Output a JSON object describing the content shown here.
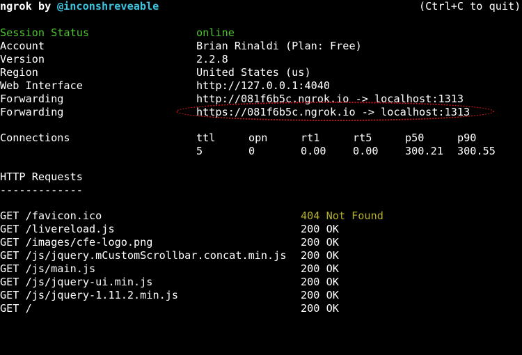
{
  "header": {
    "app_name": "ngrok",
    "by_text": "by",
    "author": "@inconshreveable",
    "quit_hint": "(Ctrl+C to quit)"
  },
  "status": [
    {
      "label": "Session Status",
      "value": "online"
    },
    {
      "label": "Account",
      "value": "Brian Rinaldi (Plan: Free)"
    },
    {
      "label": "Version",
      "value": "2.2.8"
    },
    {
      "label": "Region",
      "value": "United States (us)"
    },
    {
      "label": "Web Interface",
      "value": "http://127.0.0.1:4040"
    },
    {
      "label": "Forwarding",
      "value": "http://081f6b5c.ngrok.io -> localhost:1313"
    },
    {
      "label": "Forwarding",
      "value": "https://081f6b5c.ngrok.io -> localhost:1313"
    }
  ],
  "connections": {
    "label": "Connections",
    "headers": [
      "ttl",
      "opn",
      "rt1",
      "rt5",
      "p50",
      "p90"
    ],
    "values": [
      "5",
      "0",
      "0.00",
      "0.00",
      "300.21",
      "300.55"
    ]
  },
  "requests": {
    "title": "HTTP Requests",
    "underline": "-------------",
    "rows": [
      {
        "request": "GET /favicon.ico",
        "status": "404 Not Found"
      },
      {
        "request": "GET /livereload.js",
        "status": "200 OK"
      },
      {
        "request": "GET /images/cfe-logo.png",
        "status": "200 OK"
      },
      {
        "request": "GET /js/jquery.mCustomScrollbar.concat.min.js",
        "status": "200 OK"
      },
      {
        "request": "GET /js/main.js",
        "status": "200 OK"
      },
      {
        "request": "GET /js/jquery-ui.min.js",
        "status": "200 OK"
      },
      {
        "request": "GET /js/jquery-1.11.2.min.js",
        "status": "200 OK"
      },
      {
        "request": "GET /",
        "status": "200 OK"
      }
    ]
  },
  "colors": {
    "background": "#000000",
    "text": "#ffffff",
    "online_green": "#4ec42f",
    "author_cyan": "#3cc4e0",
    "not_found_yellow": "#b5b02c",
    "highlight_red": "#d0101a"
  }
}
